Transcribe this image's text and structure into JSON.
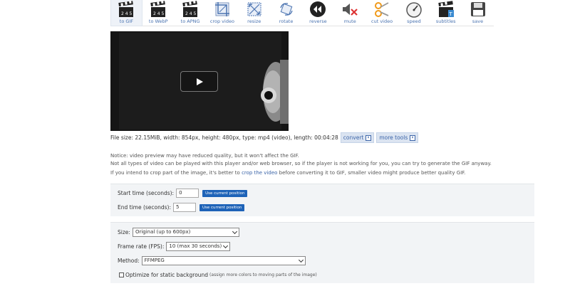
{
  "toolbar": {
    "tools": [
      {
        "label": "to GIF",
        "icon": "clapperboard-icon",
        "active": true
      },
      {
        "label": "to WebP",
        "icon": "clapperboard-icon"
      },
      {
        "label": "to APNG",
        "icon": "clapperboard-icon"
      },
      {
        "label": "crop video",
        "icon": "crop-icon"
      },
      {
        "label": "resize",
        "icon": "resize-icon"
      },
      {
        "label": "rotate",
        "icon": "rotate-icon"
      },
      {
        "label": "reverse",
        "icon": "rewind-icon"
      },
      {
        "label": "mute",
        "icon": "mute-icon"
      },
      {
        "label": "cut video",
        "icon": "scissors-icon"
      },
      {
        "label": "speed",
        "icon": "speedometer-icon"
      },
      {
        "label": "subtitles",
        "icon": "subtitles-icon"
      },
      {
        "label": "save",
        "icon": "floppy-disk-icon"
      }
    ]
  },
  "fileinfo": {
    "text": "File size: 22.15MiB, width: 854px, height: 480px, type: mp4 (video), length: 00:04:28",
    "convert_label": "convert",
    "more_tools_label": "more tools"
  },
  "notice": {
    "line1": "Notice: video preview may have reduced quality, but it won't affect the GIF.",
    "line2": "Not all types of video can be played with this player and/or web browser, so if the player is not working for you, you can try to generate the GIF anyway.",
    "line3_prefix": "If you intend to crop part of the image, it's better to ",
    "line3_link": "crop the video",
    "line3_suffix": " before converting it to GIF, smaller video might produce better quality GIF."
  },
  "time": {
    "start_label": "Start time (seconds):",
    "start_value": "0",
    "end_label": "End time (seconds):",
    "end_value": "5",
    "use_position_label": "Use current position"
  },
  "options": {
    "size_label": "Size:",
    "size_value": "Original (up to 600px)",
    "fps_label": "Frame rate (FPS):",
    "fps_value": "10 (max 30 seconds)",
    "method_label": "Method:",
    "method_value": "FFMPEG",
    "optimize_label": "Optimize for static background",
    "optimize_hint": "(assign more colors to moving parts of the image)"
  },
  "colors": {
    "accent": "#1e63b8",
    "link": "#3b64a8",
    "panel_bg": "#f2f4f6"
  }
}
